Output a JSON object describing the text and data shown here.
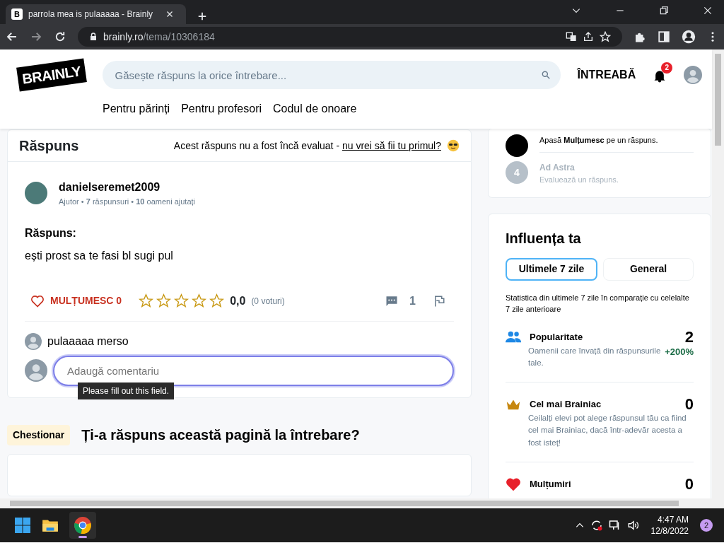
{
  "browser": {
    "tab_favicon": "B",
    "tab_title": "parrola mea is pulaaaaa - Brainly",
    "url_host": "brainly.ro",
    "url_path": "/tema/10306184"
  },
  "header": {
    "logo": "BRAINLY",
    "search_placeholder": "Găsește răspuns la orice întrebare...",
    "ask": "ÎNTREABĂ",
    "notifications": "2",
    "links": [
      "Pentru părinți",
      "Pentru profesori",
      "Codul de onoare"
    ]
  },
  "answer": {
    "heading": "Răspuns",
    "rating_note": "Acest răspuns nu a fost încă evaluat - ",
    "rating_link": "nu vrei să fii tu primul?",
    "author": "danielseremet2009",
    "stats": "Ajutor • **7** răspunsuri • **10** oameni ajutați",
    "label": "Răspuns:",
    "text": "ești prost sa te fasi bl sugi pul",
    "thanks": "MULȚUMESC 0",
    "stars": 0,
    "rating": "0,0",
    "votes": "(0 voturi)",
    "comments_count": "1",
    "comments": [
      {
        "text": "pulaaaaa merso"
      }
    ],
    "comment_placeholder": "Adaugă comentariu",
    "tooltip": "Please fill out this field."
  },
  "quiz": {
    "tag": "Chestionar",
    "question": "Ți-a răspuns această pagină la întrebare?"
  },
  "sidebar": {
    "steps": [
      {
        "done": true,
        "text": "Apasă **Mulțumesc** pe un răspuns."
      },
      {
        "done": false,
        "number": "4",
        "title": "Ad Astra",
        "text": "Evaluează un răspuns."
      }
    ],
    "influence": {
      "title": "Influența ta",
      "tabs": [
        {
          "label": "Ultimele 7 zile",
          "selected": true
        },
        {
          "label": "General",
          "selected": false
        }
      ],
      "note": "Statistica din ultimele 7 zile în comparație cu celelalte 7 zile anterioare",
      "metrics": [
        {
          "kind": "people",
          "title": "Popularitate",
          "value": "2",
          "description": "Oamenii care învață din răspunsurile tale.",
          "change": "+200%"
        },
        {
          "kind": "crown",
          "title": "Cel mai Brainiac",
          "value": "0",
          "description": "Ceilalți elevi pot alege răspunsul tău ca fiind cel mai Brainiac, dacă într-adevăr acesta a fost isteț!"
        },
        {
          "kind": "heart",
          "title": "Mulțumiri",
          "value": "0"
        }
      ]
    }
  },
  "taskbar": {
    "apps": [
      {
        "kind": "files",
        "selected": false
      },
      {
        "kind": "chrome",
        "selected": true
      }
    ],
    "time": "4:47 AM",
    "date": "12/8/2022",
    "notifications": "2"
  }
}
